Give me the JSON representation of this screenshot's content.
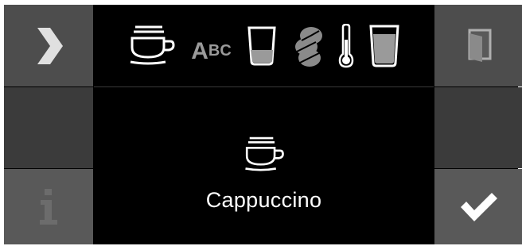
{
  "screen": {
    "selected_drink": "Cappuccino"
  },
  "top_bar": {
    "icons": [
      "cup-icon",
      "abc-name-icon",
      "glass-amount-icon",
      "coffee-beans-icon",
      "thermometer-icon",
      "milk-glass-icon"
    ],
    "abc_label_big": "A",
    "abc_label_small": "BC"
  },
  "side_buttons": {
    "left": [
      "next-arrow-icon",
      "blank",
      "info-icon"
    ],
    "right": [
      "exit-door-icon",
      "blank",
      "checkmark-icon"
    ]
  },
  "colors": {
    "background": "#000000",
    "button": "#4d4d4d",
    "icon_gray": "#9a9a9a",
    "icon_white": "#ffffff"
  }
}
